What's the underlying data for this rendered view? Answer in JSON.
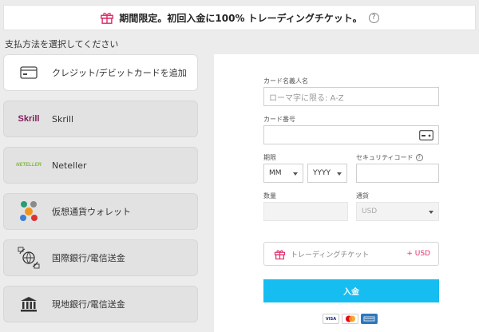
{
  "promo": {
    "text": "期間限定。初回入金に100% トレーディングチケット。",
    "help": "?"
  },
  "section_title": "支払方法を選択してください",
  "methods": [
    {
      "label": "クレジット/デビットカードを追加",
      "icon": "credit-card-icon",
      "active": true
    },
    {
      "label": "Skrill",
      "icon": "skrill-logo",
      "logo_text": "Skrill",
      "logo_color": "#811f5d"
    },
    {
      "label": "Neteller",
      "icon": "neteller-logo",
      "logo_text": "NETELLER",
      "logo_color": "#83ba3b"
    },
    {
      "label": "仮想通貨ウォレット",
      "icon": "crypto-coins-icon"
    },
    {
      "label": "国際銀行/電信送金",
      "icon": "international-bank-transfer-icon"
    },
    {
      "label": "現地銀行/電信送金",
      "icon": "local-bank-icon"
    }
  ],
  "form": {
    "cardholder": {
      "label": "カード名義人名",
      "placeholder": "ローマ字に限る: A-Z"
    },
    "card_number": {
      "label": "カード番号",
      "placeholder": ""
    },
    "expiry": {
      "label": "期限",
      "month": "MM",
      "year": "YYYY"
    },
    "security": {
      "label": "セキュリティコード",
      "help": "?"
    },
    "amount": {
      "label": "数量"
    },
    "currency": {
      "label": "通貨",
      "value": "USD"
    },
    "ticket": {
      "label": "トレーディングチケット",
      "plus": "+ USD"
    },
    "deposit_label": "入金",
    "cards": [
      "VISA",
      "MC",
      "AMEX"
    ]
  },
  "colors": {
    "accent": "#16bdf0",
    "pink": "#e0306a"
  }
}
